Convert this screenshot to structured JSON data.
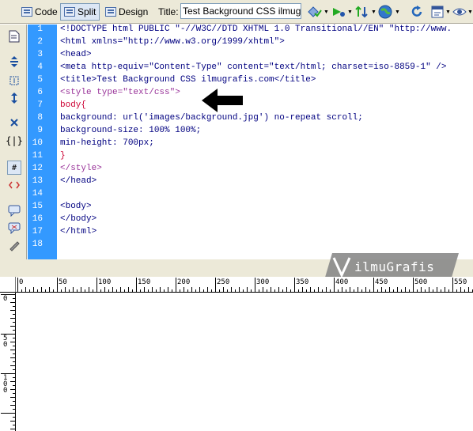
{
  "toolbar": {
    "code_label": "Code",
    "split_label": "Split",
    "design_label": "Design",
    "title_label": "Title:",
    "title_value": "Test Background CSS ilmugrafis",
    "icons": [
      "file-management-icon",
      "preview-browser-icon",
      "refresh-icon",
      "view-options-icon",
      "visual-aids-icon",
      "validate-icon",
      "browser-check-icon"
    ]
  },
  "gutter_icons": [
    "open-documents-icon",
    "collapse-tag-icon",
    "collapse-selection-icon",
    "expand-all-icon",
    "select-parent-tag-icon",
    "balance-braces-icon",
    "line-numbers-icon",
    "highlight-invalid-icon",
    "apply-comment-icon",
    "remove-comment-icon",
    "wrap-tag-icon",
    "format-source-icon",
    "more-icon"
  ],
  "editor": {
    "line_numbers": [
      "1",
      "2",
      "3",
      "4",
      "5",
      "6",
      "7",
      "8",
      "9",
      "10",
      "11",
      "12",
      "13",
      "14",
      "15",
      "16",
      "17",
      "18"
    ],
    "lines": [
      "<!DOCTYPE html PUBLIC \"-//W3C//DTD XHTML 1.0 Transitional//EN\" \"http://www.",
      "<html xmlns=\"http://www.w3.org/1999/xhtml\">",
      "<head>",
      "<meta http-equiv=\"Content-Type\" content=\"text/html; charset=iso-8859-1\" />",
      "<title>Test Background CSS ilmugrafis.com</title>",
      "<style type=\"text/css\">",
      "body{",
      "background: url('images/background.jpg') no-repeat scroll;",
      "background-size: 100% 100%;",
      "min-height: 700px;",
      "}",
      "</style>",
      "</head>",
      "",
      "<body>",
      "</body>",
      "</html>",
      ""
    ]
  },
  "watermark": {
    "text": "ilmuGrafis"
  },
  "ruler": {
    "h_labels": [
      "0",
      "50",
      "100",
      "150",
      "200",
      "250",
      "300",
      "350",
      "400",
      "450",
      "500",
      "550"
    ],
    "v_labels": [
      "0",
      "50",
      "100"
    ]
  },
  "colors": {
    "line_number_bg": "#3399ff",
    "arrow": "#000000"
  }
}
